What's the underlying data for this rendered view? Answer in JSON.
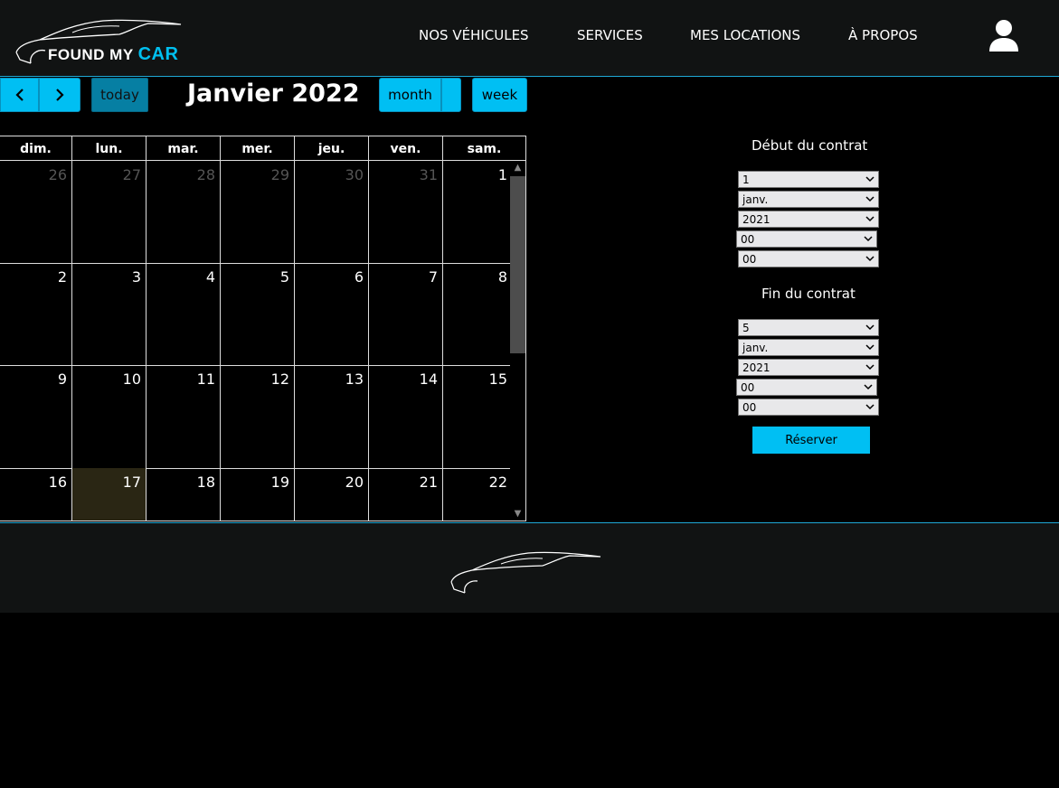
{
  "header": {
    "logo": {
      "text_found": "FOUND MY ",
      "text_car": "CAR"
    },
    "nav": [
      {
        "label": "NOS VÉHICULES"
      },
      {
        "label": "SERVICES"
      },
      {
        "label": "MES LOCATIONS"
      },
      {
        "label": "À PROPOS"
      }
    ],
    "user_icon": "user-icon"
  },
  "calendar": {
    "prev_icon": "chevron-left-icon",
    "next_icon": "chevron-right-icon",
    "today_label": "today",
    "title": "Janvier 2022",
    "month_label": "month",
    "week_label": "week",
    "weekdays": [
      "dim.",
      "lun.",
      "mar.",
      "mer.",
      "jeu.",
      "ven.",
      "sam."
    ],
    "weeks": [
      [
        "26",
        "27",
        "28",
        "29",
        "30",
        "31",
        "1"
      ],
      [
        "2",
        "3",
        "4",
        "5",
        "6",
        "7",
        "8"
      ],
      [
        "9",
        "10",
        "11",
        "12",
        "13",
        "14",
        "15"
      ],
      [
        "16",
        "17",
        "18",
        "19",
        "20",
        "21",
        "22"
      ]
    ],
    "other_month_days_first_week": 6,
    "today_date": "17",
    "colors": {
      "accent": "#00bff3",
      "today_bg": "#2a2614",
      "today_btn": "#067fa3"
    }
  },
  "contract": {
    "start_label": "Début du contrat",
    "start": {
      "day": "1",
      "month": "janv.",
      "year": "2021",
      "hour": "00",
      "minute": "00"
    },
    "end_label": "Fin du contrat",
    "end": {
      "day": "5",
      "month": "janv.",
      "year": "2021",
      "hour": "00",
      "minute": "00"
    },
    "reserve_label": "Réserver"
  }
}
